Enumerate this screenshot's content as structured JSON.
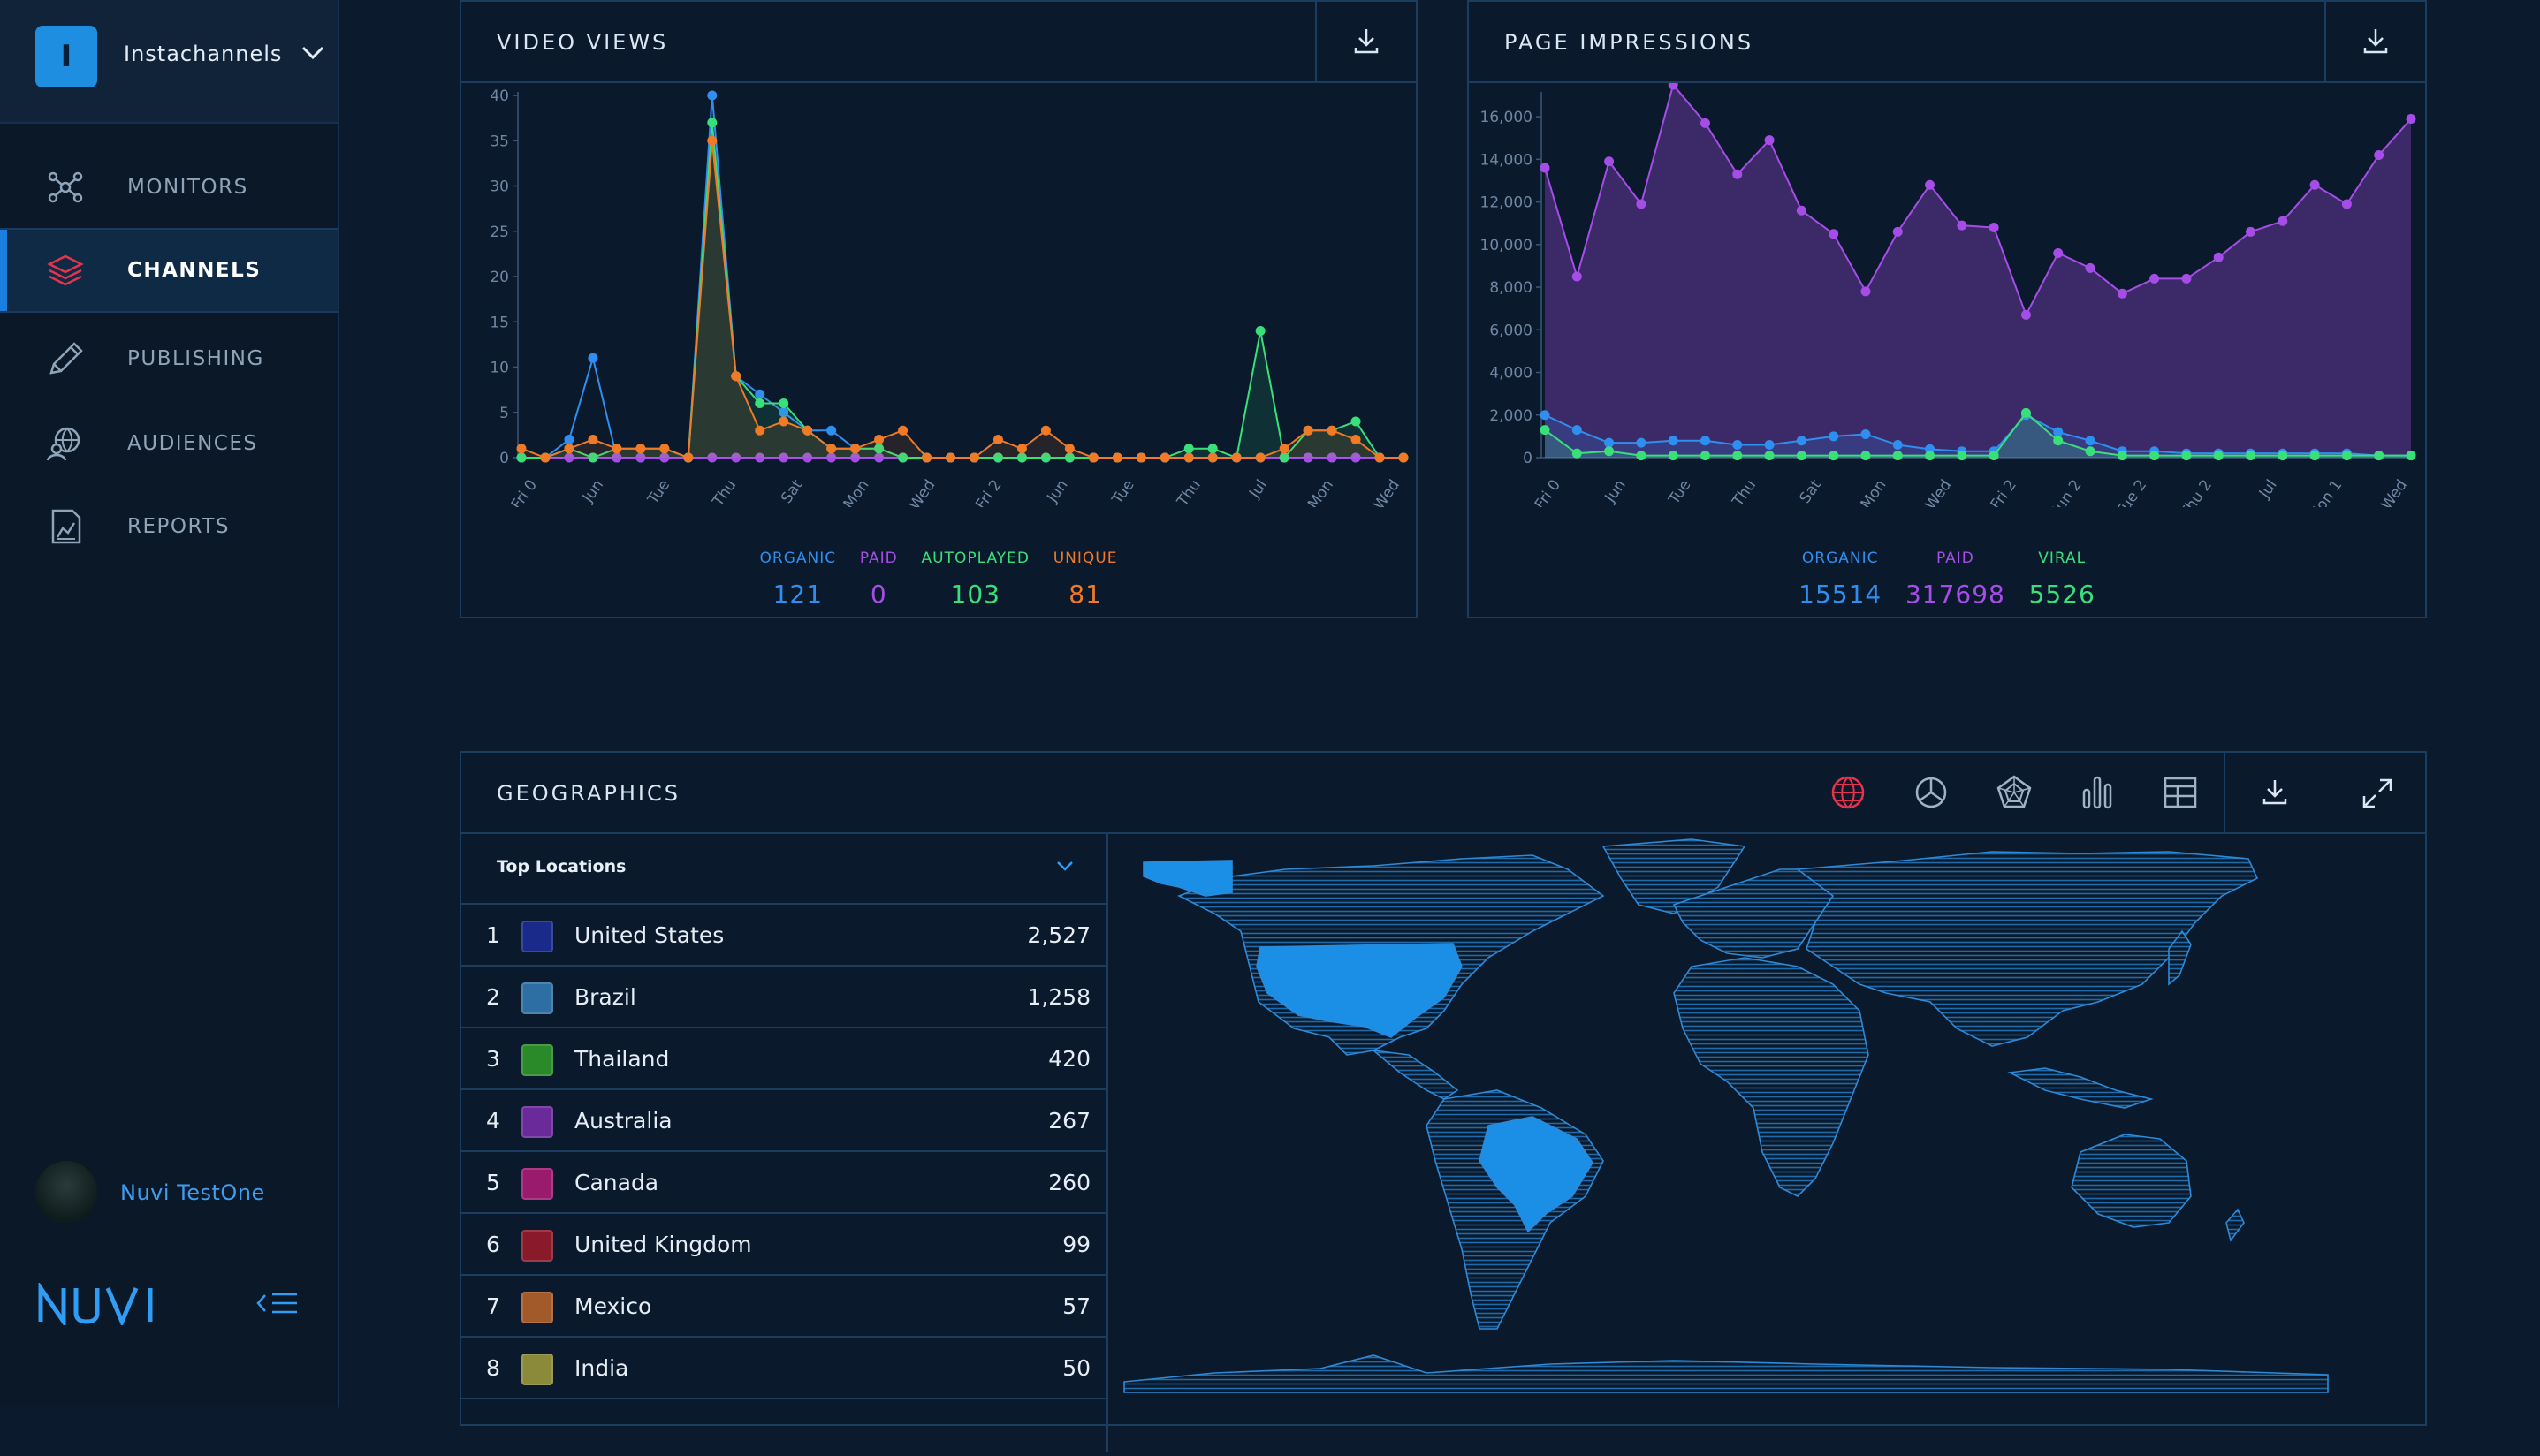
{
  "account": {
    "initial": "I",
    "name": "Instachannels"
  },
  "nav": [
    {
      "label": "MONITORS",
      "icon": "network-nodes-icon",
      "active": false
    },
    {
      "label": "CHANNELS",
      "icon": "layers-icon",
      "active": true
    },
    {
      "label": "PUBLISHING",
      "icon": "pencil-icon",
      "active": false
    },
    {
      "label": "AUDIENCES",
      "icon": "globe-person-icon",
      "active": false
    },
    {
      "label": "REPORTS",
      "icon": "report-chart-icon",
      "active": false
    }
  ],
  "user": {
    "name": "Nuvi TestOne"
  },
  "brand": {
    "logo_text": "NUVI"
  },
  "colors": {
    "organic": "#2f8ff0",
    "paid": "#a64de8",
    "autoplayed": "#39e07a",
    "unique": "#f07a26",
    "viral": "#39e07a",
    "accent": "#1b7fe0"
  },
  "video_views": {
    "title": "VIDEO VIEWS",
    "legend": [
      {
        "label": "ORGANIC",
        "value": "121",
        "color": "#2f8ff0"
      },
      {
        "label": "PAID",
        "value": "0",
        "color": "#a64de8"
      },
      {
        "label": "AUTOPLAYED",
        "value": "103",
        "color": "#39e07a"
      },
      {
        "label": "UNIQUE",
        "value": "81",
        "color": "#f07a26"
      }
    ]
  },
  "page_impressions": {
    "title": "PAGE IMPRESSIONS",
    "legend": [
      {
        "label": "ORGANIC",
        "value": "15514",
        "color": "#2f8ff0"
      },
      {
        "label": "PAID",
        "value": "317698",
        "color": "#a64de8"
      },
      {
        "label": "VIRAL",
        "value": "5526",
        "color": "#39e07a"
      }
    ]
  },
  "chart_data": [
    {
      "type": "line",
      "title": "VIDEO VIEWS",
      "ylim": [
        0,
        40
      ],
      "yticks": [
        "0",
        "5",
        "10",
        "15",
        "20",
        "25",
        "30",
        "35",
        "40"
      ],
      "xticks": [
        "Fri 0",
        "Jun",
        "Tue",
        "Thu",
        "Sat",
        "Mon",
        "Wed",
        "Fri 2",
        "Jun",
        "Tue",
        "Thu",
        "Jul",
        "Mon",
        "Wed"
      ],
      "series": [
        {
          "name": "ORGANIC",
          "color": "#2f8ff0",
          "values": [
            0,
            0,
            2,
            11,
            0,
            0,
            0,
            0,
            40,
            9,
            7,
            5,
            3,
            3,
            1,
            1,
            0,
            0,
            0,
            0,
            0,
            0,
            0,
            0,
            0,
            0,
            0,
            0,
            0,
            0,
            0,
            0,
            0,
            0,
            0,
            0,
            0,
            0
          ]
        },
        {
          "name": "PAID",
          "color": "#a64de8",
          "values": [
            0,
            0,
            0,
            0,
            0,
            0,
            0,
            0,
            0,
            0,
            0,
            0,
            0,
            0,
            0,
            0,
            0,
            0,
            0,
            0,
            0,
            0,
            0,
            0,
            0,
            0,
            0,
            0,
            0,
            0,
            0,
            0,
            0,
            0,
            0,
            0,
            0,
            0
          ]
        },
        {
          "name": "AUTOPLAYED",
          "color": "#39e07a",
          "values": [
            0,
            0,
            1,
            0,
            1,
            1,
            1,
            0,
            37,
            9,
            6,
            6,
            3,
            1,
            1,
            1,
            0,
            0,
            0,
            0,
            0,
            0,
            0,
            0,
            0,
            0,
            0,
            0,
            1,
            1,
            0,
            14,
            0,
            3,
            3,
            4,
            0,
            0
          ]
        },
        {
          "name": "UNIQUE",
          "color": "#f07a26",
          "values": [
            1,
            0,
            1,
            2,
            1,
            1,
            1,
            0,
            35,
            9,
            3,
            4,
            3,
            1,
            1,
            2,
            3,
            0,
            0,
            0,
            2,
            1,
            3,
            1,
            0,
            0,
            0,
            0,
            0,
            0,
            0,
            0,
            1,
            3,
            3,
            2,
            0,
            0
          ]
        }
      ]
    },
    {
      "type": "area",
      "title": "PAGE IMPRESSIONS",
      "ylim": [
        0,
        17000
      ],
      "yticks": [
        "0",
        "2,000",
        "4,000",
        "6,000",
        "8,000",
        "10,000",
        "12,000",
        "14,000",
        "16,000"
      ],
      "xticks": [
        "Fri 0",
        "Jun",
        "Tue",
        "Thu",
        "Sat",
        "Mon",
        "Wed",
        "Fri 2",
        "Jun 2",
        "Tue 2",
        "Thu 2",
        "Jul",
        "Mon 1",
        "Wed"
      ],
      "series": [
        {
          "name": "PAID",
          "color": "#a64de8",
          "values": [
            13600,
            8500,
            13900,
            11900,
            17500,
            15700,
            13300,
            14900,
            11600,
            10500,
            7800,
            10600,
            12800,
            10900,
            10800,
            6700,
            9600,
            8900,
            7700,
            8400,
            8400,
            9400,
            10600,
            11100,
            12800,
            11900,
            14200,
            15900
          ]
        },
        {
          "name": "ORGANIC",
          "color": "#2f8ff0",
          "values": [
            2000,
            1300,
            700,
            700,
            800,
            800,
            600,
            600,
            800,
            1000,
            1100,
            600,
            400,
            300,
            300,
            2000,
            1200,
            800,
            300,
            300,
            200,
            200,
            200,
            200,
            200,
            200,
            100,
            100
          ]
        },
        {
          "name": "VIRAL",
          "color": "#39e07a",
          "values": [
            1300,
            200,
            300,
            100,
            100,
            100,
            100,
            100,
            100,
            100,
            100,
            100,
            100,
            100,
            100,
            2100,
            800,
            300,
            100,
            100,
            100,
            100,
            100,
            100,
            100,
            100,
            100,
            100
          ]
        }
      ]
    }
  ],
  "geographics": {
    "title": "GEOGRAPHICS",
    "dropdown_label": "Top Locations",
    "tools": [
      "globe-map-icon",
      "pie-chart-icon",
      "radar-chart-icon",
      "bar-chart-icon",
      "table-grid-icon"
    ],
    "locations": [
      {
        "rank": "1",
        "name": "United States",
        "value": "2,527",
        "color": "#1a2a8a"
      },
      {
        "rank": "2",
        "name": "Brazil",
        "value": "1,258",
        "color": "#2e6fa3"
      },
      {
        "rank": "3",
        "name": "Thailand",
        "value": "420",
        "color": "#2a8a2a"
      },
      {
        "rank": "4",
        "name": "Australia",
        "value": "267",
        "color": "#6a2a9a"
      },
      {
        "rank": "5",
        "name": "Canada",
        "value": "260",
        "color": "#9a1a6e"
      },
      {
        "rank": "6",
        "name": "United Kingdom",
        "value": "99",
        "color": "#8a1a2a"
      },
      {
        "rank": "7",
        "name": "Mexico",
        "value": "57",
        "color": "#a35a2a"
      },
      {
        "rank": "8",
        "name": "India",
        "value": "50",
        "color": "#8a8a3a"
      }
    ]
  }
}
